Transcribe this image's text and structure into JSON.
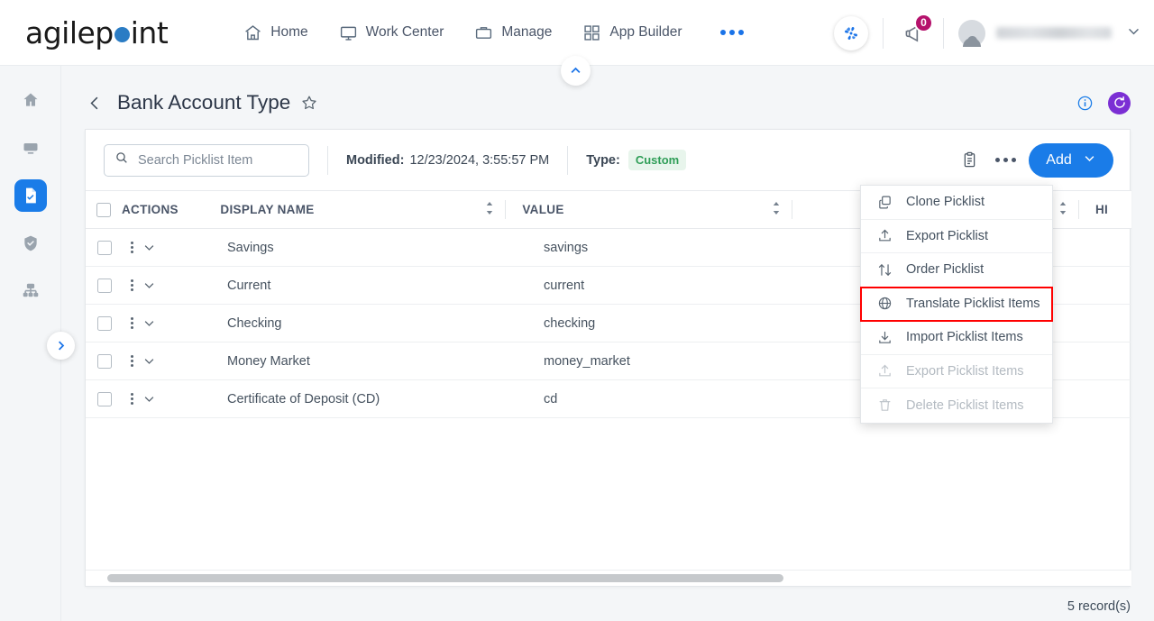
{
  "brand": {
    "name_part1": "agilep",
    "name_part2": "int",
    "accent": "#2b7cc4"
  },
  "topnav": {
    "items": [
      {
        "label": "Home",
        "icon": "home-icon"
      },
      {
        "label": "Work Center",
        "icon": "monitor-icon"
      },
      {
        "label": "Manage",
        "icon": "briefcase-icon"
      },
      {
        "label": "App Builder",
        "icon": "grid-icon"
      }
    ],
    "overflow_icon": "more-dots-icon",
    "pulse_icon": "pulse-icon",
    "notifications_icon": "megaphone-icon",
    "notifications_count": "0",
    "account_caret": "chevron-down-icon"
  },
  "rail": {
    "items": [
      {
        "name": "home-icon",
        "active": false
      },
      {
        "name": "work-center-icon",
        "active": false
      },
      {
        "name": "picklist-document-icon",
        "active": true
      },
      {
        "name": "shield-check-icon",
        "active": false
      },
      {
        "name": "org-hierarchy-icon",
        "active": false
      }
    ],
    "expand_icon": "chevron-right-icon"
  },
  "pageheader": {
    "collapse_icon": "chevron-up-icon",
    "back_icon": "chevron-left-icon",
    "title": "Bank Account Type",
    "favorite_icon": "star-icon",
    "info_icon": "info-icon",
    "refresh_icon": "refresh-icon",
    "refresh_color": "#7b2fd4"
  },
  "toolbar": {
    "search_placeholder": "Search Picklist Item",
    "search_value": "",
    "search_icon": "search-icon",
    "modified_label": "Modified:",
    "modified_value": "12/23/2024, 3:55:57 PM",
    "type_label": "Type:",
    "type_value": "Custom",
    "type_badge_color": "#2f9e57",
    "notes_icon": "clipboard-icon",
    "more_icon": "more-dots-icon",
    "add_label": "Add",
    "add_caret_icon": "chevron-down-icon",
    "add_color": "#1a7ce8"
  },
  "table": {
    "columns": [
      {
        "key": "actions",
        "label": "ACTIONS",
        "sortable": false
      },
      {
        "key": "display_name",
        "label": "DISPLAY NAME",
        "sortable": true
      },
      {
        "key": "value",
        "label": "VALUE",
        "sortable": true
      },
      {
        "key": "hidden",
        "label": "",
        "sortable": true
      },
      {
        "key": "hi",
        "label": "HI",
        "sortable": false
      }
    ],
    "select_all_checked": false,
    "rows": [
      {
        "display_name": "Savings",
        "value": "savings",
        "checked": false
      },
      {
        "display_name": "Current",
        "value": "current",
        "checked": false
      },
      {
        "display_name": "Checking",
        "value": "checking",
        "checked": false
      },
      {
        "display_name": "Money Market",
        "value": "money_market",
        "checked": false
      },
      {
        "display_name": "Certificate of Deposit (CD)",
        "value": "cd",
        "checked": false
      }
    ],
    "row_kebab_icon": "kebab-menu-icon",
    "row_expand_icon": "chevron-down-icon"
  },
  "contextmenu": {
    "items": [
      {
        "label": "Clone Picklist",
        "icon": "copy-icon",
        "disabled": false,
        "highlighted": false
      },
      {
        "label": "Export Picklist",
        "icon": "upload-icon",
        "disabled": false,
        "highlighted": false
      },
      {
        "label": "Order Picklist",
        "icon": "sort-updown-icon",
        "disabled": false,
        "highlighted": false
      },
      {
        "label": "Translate Picklist Items",
        "icon": "globe-icon",
        "disabled": false,
        "highlighted": true
      },
      {
        "label": "Import Picklist Items",
        "icon": "download-icon",
        "disabled": false,
        "highlighted": false
      },
      {
        "label": "Export Picklist Items",
        "icon": "upload-icon",
        "disabled": true,
        "highlighted": false
      },
      {
        "label": "Delete Picklist Items",
        "icon": "trash-icon",
        "disabled": true,
        "highlighted": false
      }
    ],
    "highlight_color": "#ff0000"
  },
  "footer": {
    "record_count": "5 record(s)"
  }
}
